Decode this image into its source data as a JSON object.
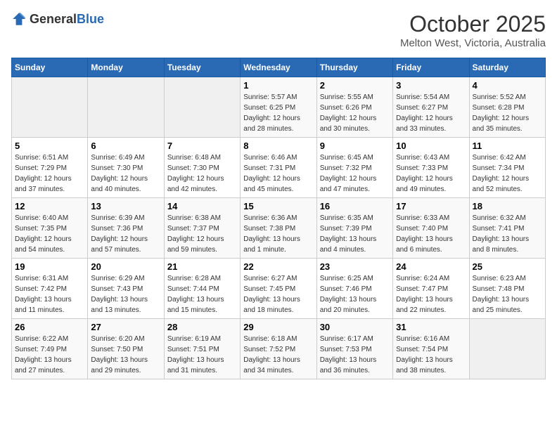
{
  "logo": {
    "general": "General",
    "blue": "Blue"
  },
  "title": "October 2025",
  "subtitle": "Melton West, Victoria, Australia",
  "days_of_week": [
    "Sunday",
    "Monday",
    "Tuesday",
    "Wednesday",
    "Thursday",
    "Friday",
    "Saturday"
  ],
  "weeks": [
    [
      {
        "day": "",
        "info": ""
      },
      {
        "day": "",
        "info": ""
      },
      {
        "day": "",
        "info": ""
      },
      {
        "day": "1",
        "info": "Sunrise: 5:57 AM\nSunset: 6:25 PM\nDaylight: 12 hours\nand 28 minutes."
      },
      {
        "day": "2",
        "info": "Sunrise: 5:55 AM\nSunset: 6:26 PM\nDaylight: 12 hours\nand 30 minutes."
      },
      {
        "day": "3",
        "info": "Sunrise: 5:54 AM\nSunset: 6:27 PM\nDaylight: 12 hours\nand 33 minutes."
      },
      {
        "day": "4",
        "info": "Sunrise: 5:52 AM\nSunset: 6:28 PM\nDaylight: 12 hours\nand 35 minutes."
      }
    ],
    [
      {
        "day": "5",
        "info": "Sunrise: 6:51 AM\nSunset: 7:29 PM\nDaylight: 12 hours\nand 37 minutes."
      },
      {
        "day": "6",
        "info": "Sunrise: 6:49 AM\nSunset: 7:30 PM\nDaylight: 12 hours\nand 40 minutes."
      },
      {
        "day": "7",
        "info": "Sunrise: 6:48 AM\nSunset: 7:30 PM\nDaylight: 12 hours\nand 42 minutes."
      },
      {
        "day": "8",
        "info": "Sunrise: 6:46 AM\nSunset: 7:31 PM\nDaylight: 12 hours\nand 45 minutes."
      },
      {
        "day": "9",
        "info": "Sunrise: 6:45 AM\nSunset: 7:32 PM\nDaylight: 12 hours\nand 47 minutes."
      },
      {
        "day": "10",
        "info": "Sunrise: 6:43 AM\nSunset: 7:33 PM\nDaylight: 12 hours\nand 49 minutes."
      },
      {
        "day": "11",
        "info": "Sunrise: 6:42 AM\nSunset: 7:34 PM\nDaylight: 12 hours\nand 52 minutes."
      }
    ],
    [
      {
        "day": "12",
        "info": "Sunrise: 6:40 AM\nSunset: 7:35 PM\nDaylight: 12 hours\nand 54 minutes."
      },
      {
        "day": "13",
        "info": "Sunrise: 6:39 AM\nSunset: 7:36 PM\nDaylight: 12 hours\nand 57 minutes."
      },
      {
        "day": "14",
        "info": "Sunrise: 6:38 AM\nSunset: 7:37 PM\nDaylight: 12 hours\nand 59 minutes."
      },
      {
        "day": "15",
        "info": "Sunrise: 6:36 AM\nSunset: 7:38 PM\nDaylight: 13 hours\nand 1 minute."
      },
      {
        "day": "16",
        "info": "Sunrise: 6:35 AM\nSunset: 7:39 PM\nDaylight: 13 hours\nand 4 minutes."
      },
      {
        "day": "17",
        "info": "Sunrise: 6:33 AM\nSunset: 7:40 PM\nDaylight: 13 hours\nand 6 minutes."
      },
      {
        "day": "18",
        "info": "Sunrise: 6:32 AM\nSunset: 7:41 PM\nDaylight: 13 hours\nand 8 minutes."
      }
    ],
    [
      {
        "day": "19",
        "info": "Sunrise: 6:31 AM\nSunset: 7:42 PM\nDaylight: 13 hours\nand 11 minutes."
      },
      {
        "day": "20",
        "info": "Sunrise: 6:29 AM\nSunset: 7:43 PM\nDaylight: 13 hours\nand 13 minutes."
      },
      {
        "day": "21",
        "info": "Sunrise: 6:28 AM\nSunset: 7:44 PM\nDaylight: 13 hours\nand 15 minutes."
      },
      {
        "day": "22",
        "info": "Sunrise: 6:27 AM\nSunset: 7:45 PM\nDaylight: 13 hours\nand 18 minutes."
      },
      {
        "day": "23",
        "info": "Sunrise: 6:25 AM\nSunset: 7:46 PM\nDaylight: 13 hours\nand 20 minutes."
      },
      {
        "day": "24",
        "info": "Sunrise: 6:24 AM\nSunset: 7:47 PM\nDaylight: 13 hours\nand 22 minutes."
      },
      {
        "day": "25",
        "info": "Sunrise: 6:23 AM\nSunset: 7:48 PM\nDaylight: 13 hours\nand 25 minutes."
      }
    ],
    [
      {
        "day": "26",
        "info": "Sunrise: 6:22 AM\nSunset: 7:49 PM\nDaylight: 13 hours\nand 27 minutes."
      },
      {
        "day": "27",
        "info": "Sunrise: 6:20 AM\nSunset: 7:50 PM\nDaylight: 13 hours\nand 29 minutes."
      },
      {
        "day": "28",
        "info": "Sunrise: 6:19 AM\nSunset: 7:51 PM\nDaylight: 13 hours\nand 31 minutes."
      },
      {
        "day": "29",
        "info": "Sunrise: 6:18 AM\nSunset: 7:52 PM\nDaylight: 13 hours\nand 34 minutes."
      },
      {
        "day": "30",
        "info": "Sunrise: 6:17 AM\nSunset: 7:53 PM\nDaylight: 13 hours\nand 36 minutes."
      },
      {
        "day": "31",
        "info": "Sunrise: 6:16 AM\nSunset: 7:54 PM\nDaylight: 13 hours\nand 38 minutes."
      },
      {
        "day": "",
        "info": ""
      }
    ]
  ]
}
